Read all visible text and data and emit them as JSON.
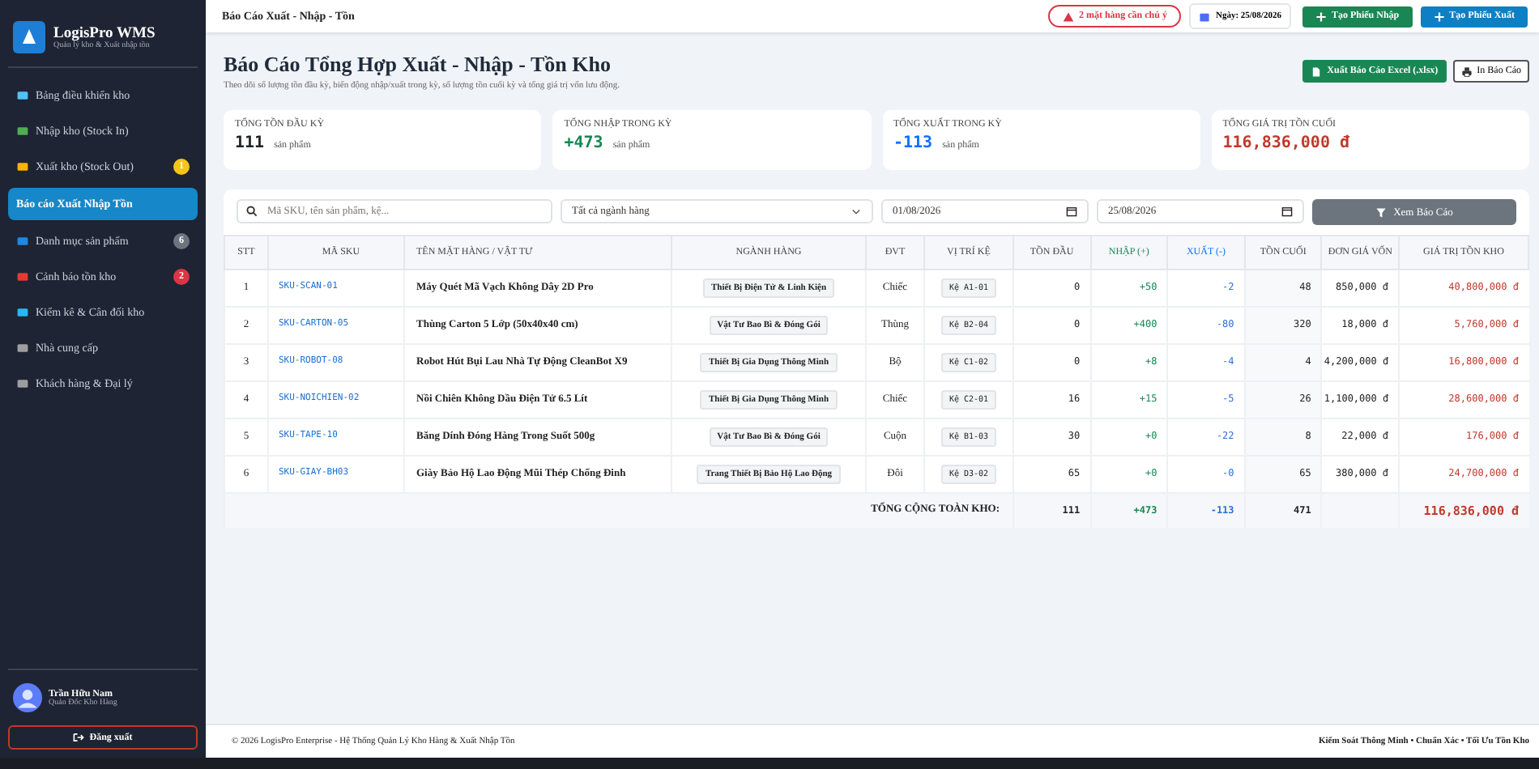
{
  "sidebar": {
    "brand": "LogisPro WMS",
    "tagline": "Quản lý kho & Xuất nhập tồn",
    "items": [
      {
        "label": "Bảng điều khiển kho",
        "selected": false
      },
      {
        "label": "Nhập kho (Stock In)",
        "selected": false
      },
      {
        "label": "Xuất kho (Stock Out)",
        "selected": false,
        "badge": "1",
        "color": "#f5c518"
      },
      {
        "label": "Báo cáo Xuất Nhập Tồn",
        "selected": true
      },
      {
        "label": "Danh mục sản phẩm",
        "selected": false,
        "badge": "6",
        "color": "#6c757d"
      },
      {
        "label": "Cảnh báo tồn kho",
        "selected": false,
        "badge": "2",
        "color": "#dc3545"
      },
      {
        "label": "Kiểm kê & Cân đối kho",
        "selected": false
      },
      {
        "label": "Nhà cung cấp",
        "selected": false
      },
      {
        "label": "Khách hàng & Đại lý",
        "selected": false
      }
    ],
    "user": {
      "name": "Trần Hữu Nam",
      "role": "Quản Đốc Kho Hàng"
    },
    "logout": "Đăng xuất"
  },
  "topbar": {
    "breadcrumb": "Báo Cáo Xuất - Nhập - Tồn",
    "alert": "2 mặt hàng cần chú ý",
    "date": "Ngày: 25/08/2026",
    "buttons": [
      "Tạo Phiếu Nhập",
      "Tạo Phiếu Xuất"
    ]
  },
  "page": {
    "title": "Báo Cáo Tổng Hợp Xuất - Nhập - Tồn Kho",
    "subtitle": "Theo dõi số lượng tồn đầu kỳ, biến động nhập/xuất trong kỳ, số lượng tồn cuối kỳ và tổng giá trị vốn lưu động.",
    "export": "Xuất Báo Cáo Excel (.xlsx)",
    "print": "In Báo Cáo"
  },
  "stats": [
    {
      "label": "TỔNG TỒN ĐẦU KỲ",
      "value": "111",
      "unit": "sản phẩm",
      "color": "#212529"
    },
    {
      "label": "TỔNG NHẬP TRONG KỲ",
      "value": "+473",
      "unit": "sản phẩm",
      "color": "#198754"
    },
    {
      "label": "TỔNG XUẤT TRONG KỲ",
      "value": "-113",
      "unit": "sản phẩm",
      "color": "#0d6efd"
    },
    {
      "label": "TỔNG GIÁ TRỊ TỒN CUỐI",
      "value": "116,836,000 đ",
      "color": "#c0392b"
    }
  ],
  "filters": {
    "search_placeholder": "Mã SKU, tên sản phẩm, kệ...",
    "category": "Tất cả ngành hàng",
    "from": "01/08/2026",
    "to": "25/08/2026",
    "button": "Xem Báo Cáo"
  },
  "table": {
    "columns": [
      "STT",
      "MÃ SKU",
      "TÊN MẶT HÀNG / VẬT TƯ",
      "NGÀNH HÀNG",
      "ĐVT",
      "VỊ TRÍ KỆ",
      "TỒN ĐẦU",
      "NHẬP (+)",
      "XUẤT (-)",
      "TỒN CUỐI",
      "ĐƠN GIÁ VỐN",
      "GIÁ TRỊ TỒN KHO"
    ],
    "rows": [
      [
        "1",
        "SKU-SCAN-01",
        "Máy Quét Mã Vạch Không Dây 2D Pro",
        "Thiết Bị Điện Tử & Linh Kiện",
        "Chiếc",
        "Kệ A1-01",
        "0",
        "+50",
        "-2",
        "48",
        "850,000 đ",
        "40,800,000 đ"
      ],
      [
        "2",
        "SKU-CARTON-05",
        "Thùng Carton 5 Lớp (50x40x40 cm)",
        "Vật Tư Bao Bì & Đóng Gói",
        "Thùng",
        "Kệ B2-04",
        "0",
        "+400",
        "-80",
        "320",
        "18,000 đ",
        "5,760,000 đ"
      ],
      [
        "3",
        "SKU-ROBOT-08",
        "Robot Hút Bụi Lau Nhà Tự Động CleanBot X9",
        "Thiết Bị Gia Dụng Thông Minh",
        "Bộ",
        "Kệ C1-02",
        "0",
        "+8",
        "-4",
        "4",
        "4,200,000 đ",
        "16,800,000 đ"
      ],
      [
        "4",
        "SKU-NOICHIEN-02",
        "Nồi Chiên Không Dầu Điện Tử 6.5 Lít",
        "Thiết Bị Gia Dụng Thông Minh",
        "Chiếc",
        "Kệ C2-01",
        "16",
        "+15",
        "-5",
        "26",
        "1,100,000 đ",
        "28,600,000 đ"
      ],
      [
        "5",
        "SKU-TAPE-10",
        "Băng Dính Đóng Hàng Trong Suốt 500g",
        "Vật Tư Bao Bì & Đóng Gói",
        "Cuộn",
        "Kệ B1-03",
        "30",
        "+0",
        "-22",
        "8",
        "22,000 đ",
        "176,000 đ"
      ],
      [
        "6",
        "SKU-GIAY-BH03",
        "Giày Bảo Hộ Lao Động Mũi Thép Chống Đinh",
        "Trang Thiết Bị Bảo Hộ Lao Động",
        "Đôi",
        "Kệ D3-02",
        "65",
        "+0",
        "-0",
        "65",
        "380,000 đ",
        "24,700,000 đ"
      ]
    ],
    "total": {
      "label": "TỔNG CỘNG TOÀN KHO:",
      "values": [
        "111",
        "+473",
        "-113",
        "471"
      ],
      "stock_value": "116,836,000 đ"
    }
  },
  "footer": {
    "left": "© 2026 LogisPro Enterprise - Hệ Thống Quản Lý Kho Hàng & Xuất Nhập Tồn",
    "right": "Kiểm Soát Thông Minh • Chuẩn Xác • Tối Ưu Tồn Kho"
  }
}
